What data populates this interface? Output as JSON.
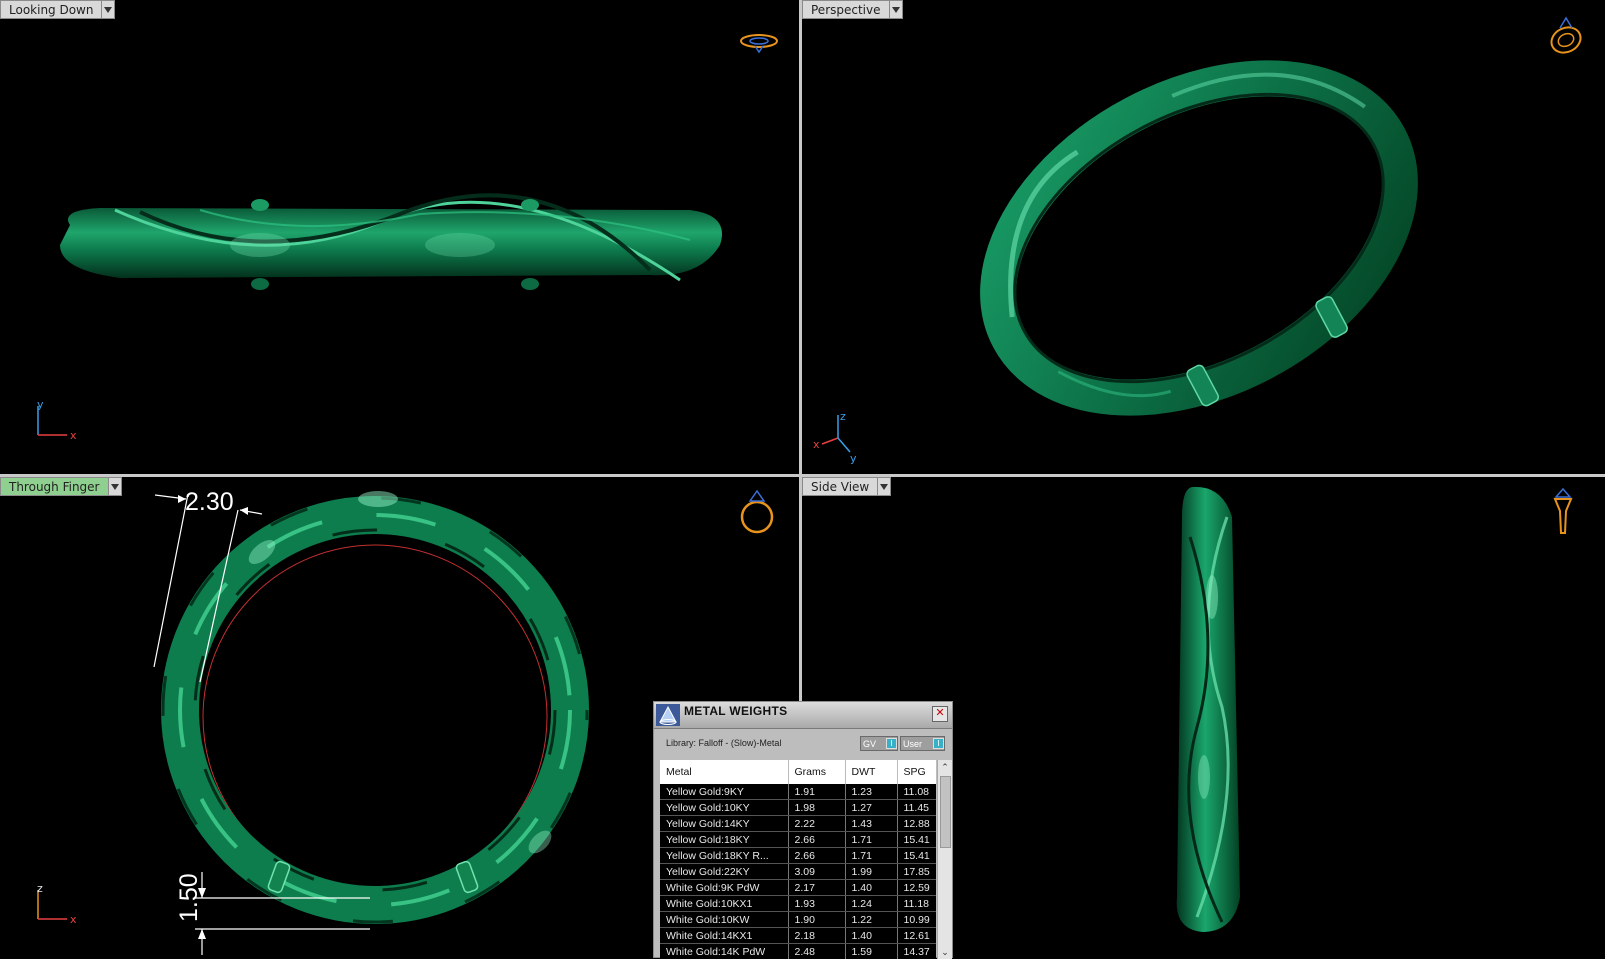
{
  "viewports": {
    "top_left": {
      "label": "Looking Down",
      "axis": {
        "v": "y",
        "h": "x"
      }
    },
    "top_right": {
      "label": "Perspective",
      "axis": {
        "v": "z",
        "h": "y",
        "neg": "x"
      }
    },
    "bottom_left": {
      "label": "Through Finger",
      "axis": {
        "v": "z",
        "h": "x"
      },
      "dimensions": {
        "width": "2.30",
        "height": "1.50"
      }
    },
    "bottom_right": {
      "label": "Side View"
    }
  },
  "metal_weights": {
    "title": "METAL WEIGHTS",
    "library": "Library: Falloff - (Slow)-Metal",
    "toggle_gv": "GV",
    "toggle_user": "User",
    "toggle_knob": "I",
    "close_symbol": "✕",
    "columns": [
      "Metal",
      "Grams",
      "DWT",
      "SPG"
    ],
    "rows": [
      [
        "Yellow Gold:9KY",
        "1.91",
        "1.23",
        "11.08"
      ],
      [
        "Yellow Gold:10KY",
        "1.98",
        "1.27",
        "11.45"
      ],
      [
        "Yellow Gold:14KY",
        "2.22",
        "1.43",
        "12.88"
      ],
      [
        "Yellow Gold:18KY",
        "2.66",
        "1.71",
        "15.41"
      ],
      [
        "Yellow Gold:18KY R...",
        "2.66",
        "1.71",
        "15.41"
      ],
      [
        "Yellow Gold:22KY",
        "3.09",
        "1.99",
        "17.85"
      ],
      [
        "White Gold:9K PdW",
        "2.17",
        "1.40",
        "12.59"
      ],
      [
        "White Gold:10KX1",
        "1.93",
        "1.24",
        "11.18"
      ],
      [
        "White Gold:10KW",
        "1.90",
        "1.22",
        "10.99"
      ],
      [
        "White Gold:14KX1",
        "2.18",
        "1.40",
        "12.61"
      ],
      [
        "White Gold:14K PdW",
        "2.48",
        "1.59",
        "14.37"
      ]
    ],
    "scroll_up": "⌃",
    "scroll_down": "⌄"
  },
  "colors": {
    "ring": "#0f8a55",
    "ring_highlight": "#5fd3a0",
    "ring_dark": "#05331f",
    "nav_cube": "#e8941c",
    "active_label": "#8fcf8f"
  }
}
